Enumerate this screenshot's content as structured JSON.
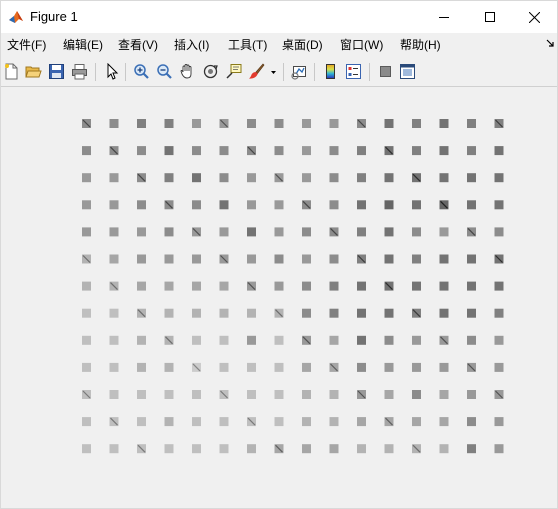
{
  "window": {
    "title": "Figure 1"
  },
  "menu": {
    "items": [
      {
        "label": "文件(F)"
      },
      {
        "label": "编辑(E)"
      },
      {
        "label": "查看(V)"
      },
      {
        "label": "插入(I)"
      },
      {
        "label": "工具(T)"
      },
      {
        "label": "桌面(D)"
      },
      {
        "label": "窗口(W)"
      },
      {
        "label": "帮助(H)"
      }
    ]
  },
  "toolbar": {
    "icons": [
      "new-figure-icon",
      "open-file-icon",
      "save-icon",
      "print-icon",
      "edit-plot-arrow-icon",
      "zoom-in-icon",
      "zoom-out-icon",
      "pan-hand-icon",
      "rotate-3d-icon",
      "data-cursor-icon",
      "brush-icon",
      "brush-dropdown-icon",
      "link-plot-icon",
      "insert-colorbar-icon",
      "insert-legend-icon",
      "hide-plot-tools-icon",
      "show-plot-tools-icon"
    ]
  },
  "figure": {
    "tile_rows": 13,
    "tile_cols": 16,
    "tile_shades": [
      [
        0.55,
        0.55,
        0.5,
        0.5,
        0.6,
        0.6,
        0.55,
        0.55,
        0.6,
        0.6,
        0.55,
        0.45,
        0.5,
        0.45,
        0.5,
        0.5
      ],
      [
        0.55,
        0.55,
        0.55,
        0.45,
        0.55,
        0.55,
        0.55,
        0.55,
        0.6,
        0.55,
        0.5,
        0.45,
        0.5,
        0.45,
        0.5,
        0.45
      ],
      [
        0.6,
        0.6,
        0.55,
        0.5,
        0.45,
        0.55,
        0.6,
        0.6,
        0.6,
        0.55,
        0.5,
        0.45,
        0.45,
        0.45,
        0.45,
        0.45
      ],
      [
        0.6,
        0.6,
        0.55,
        0.55,
        0.55,
        0.45,
        0.6,
        0.6,
        0.55,
        0.55,
        0.45,
        0.4,
        0.45,
        0.4,
        0.45,
        0.45
      ],
      [
        0.6,
        0.6,
        0.6,
        0.55,
        0.6,
        0.6,
        0.45,
        0.6,
        0.55,
        0.55,
        0.5,
        0.45,
        0.55,
        0.6,
        0.55,
        0.55
      ],
      [
        0.7,
        0.65,
        0.6,
        0.6,
        0.6,
        0.6,
        0.6,
        0.55,
        0.6,
        0.55,
        0.5,
        0.45,
        0.5,
        0.45,
        0.45,
        0.45
      ],
      [
        0.7,
        0.7,
        0.65,
        0.65,
        0.65,
        0.65,
        0.6,
        0.6,
        0.55,
        0.5,
        0.45,
        0.45,
        0.45,
        0.45,
        0.45,
        0.45
      ],
      [
        0.75,
        0.75,
        0.7,
        0.7,
        0.7,
        0.7,
        0.7,
        0.7,
        0.55,
        0.5,
        0.45,
        0.45,
        0.5,
        0.45,
        0.45,
        0.5
      ],
      [
        0.75,
        0.75,
        0.7,
        0.7,
        0.75,
        0.75,
        0.6,
        0.75,
        0.6,
        0.65,
        0.45,
        0.55,
        0.6,
        0.6,
        0.55,
        0.6
      ],
      [
        0.75,
        0.75,
        0.7,
        0.7,
        0.8,
        0.75,
        0.75,
        0.75,
        0.65,
        0.65,
        0.55,
        0.6,
        0.6,
        0.6,
        0.6,
        0.6
      ],
      [
        0.75,
        0.75,
        0.75,
        0.75,
        0.75,
        0.75,
        0.75,
        0.75,
        0.7,
        0.7,
        0.6,
        0.65,
        0.55,
        0.65,
        0.6,
        0.6
      ],
      [
        0.75,
        0.75,
        0.75,
        0.7,
        0.75,
        0.75,
        0.75,
        0.75,
        0.7,
        0.7,
        0.65,
        0.65,
        0.65,
        0.65,
        0.55,
        0.6
      ],
      [
        0.75,
        0.75,
        0.75,
        0.75,
        0.75,
        0.75,
        0.7,
        0.65,
        0.65,
        0.65,
        0.7,
        0.7,
        0.7,
        0.7,
        0.5,
        0.6
      ]
    ]
  }
}
